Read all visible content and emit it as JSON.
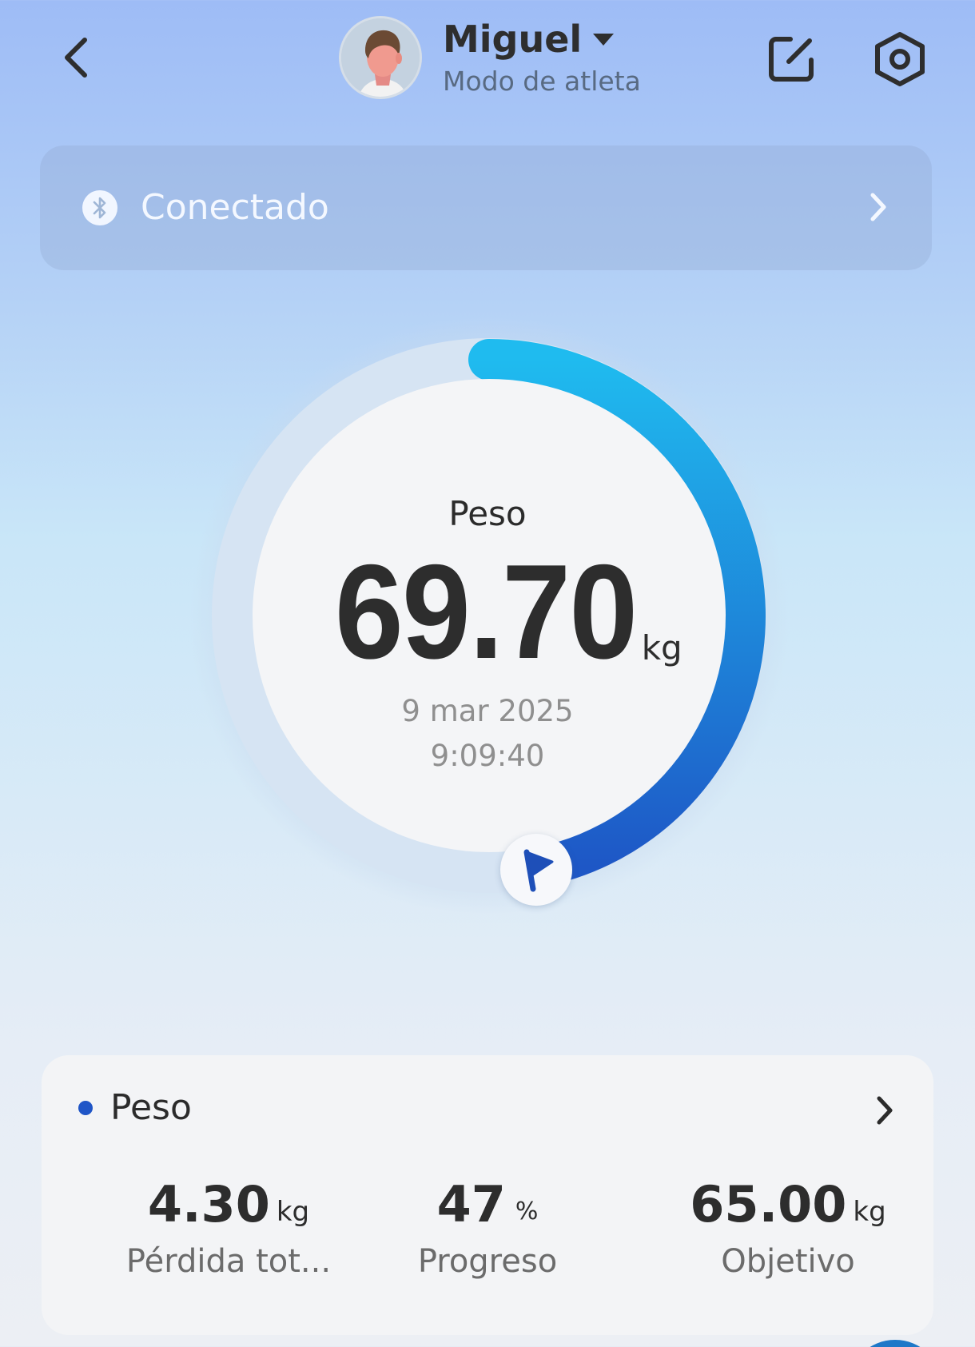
{
  "header": {
    "profile_name": "Miguel",
    "profile_mode": "Modo de atleta",
    "icons": {
      "back": "chevron-left-icon",
      "edit": "edit-square-icon",
      "settings": "settings-hexagon-icon",
      "profile_menu": "caret-down-icon"
    }
  },
  "connection": {
    "status_label": "Conectado",
    "icon": "bluetooth-icon"
  },
  "gauge": {
    "label": "Peso",
    "value": "69.70",
    "unit": "kg",
    "date": "9 mar 2025",
    "time": "9:09:40",
    "progress_fraction": 0.47,
    "goal_icon": "flag-icon",
    "colors": {
      "arc_start": "#1fbbef",
      "arc_end": "#1e57c6",
      "track": "#d6e4f3",
      "disc": "#f4f5f7"
    }
  },
  "card": {
    "title": "Peso",
    "dot_color": "#1f55c7",
    "stats": [
      {
        "value": "4.30",
        "unit": "kg",
        "label": "Pérdida tot..."
      },
      {
        "value": "47",
        "unit": "%",
        "label": "Progreso"
      },
      {
        "value": "65.00",
        "unit": "kg",
        "label": "Objetivo"
      }
    ]
  }
}
